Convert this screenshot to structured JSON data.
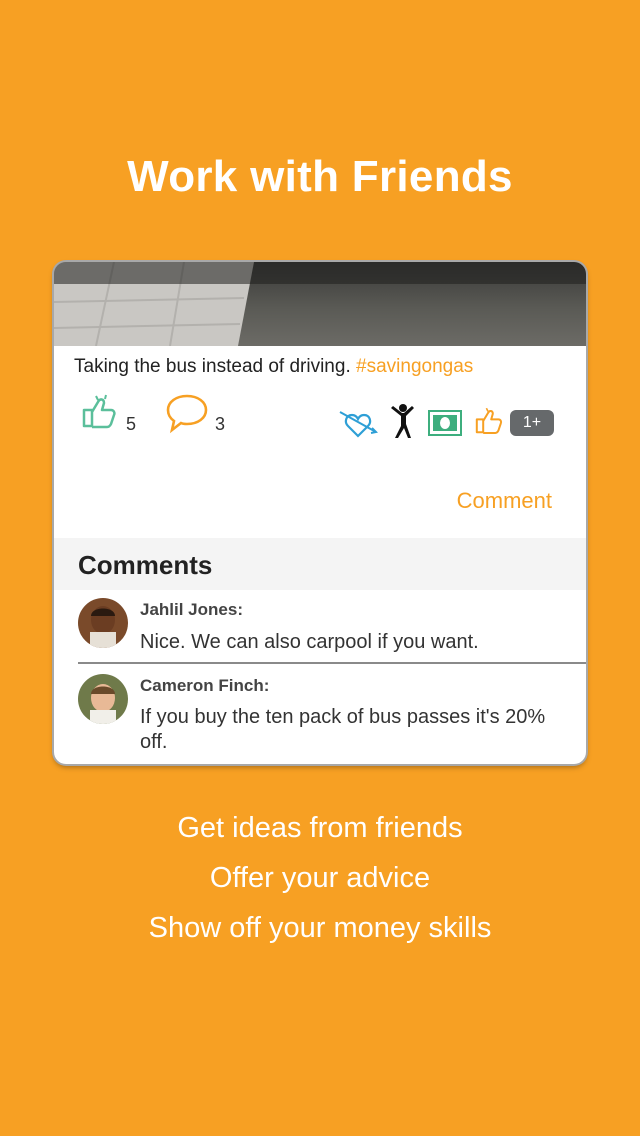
{
  "headline": "Work with Friends",
  "post": {
    "text": "Taking the bus instead of driving.",
    "hashtag": "#savingongas",
    "likes_count": "5",
    "comments_count": "3",
    "more_badge": "1+",
    "comment_link": "Comment"
  },
  "comments": {
    "header": "Comments",
    "items": [
      {
        "name": "Jahlil Jones:",
        "text": "Nice. We can also carpool if you want."
      },
      {
        "name": "Cameron Finch:",
        "text": "If you buy the ten pack of bus passes it's 20% off."
      }
    ]
  },
  "taglines": [
    "Get ideas from friends",
    "Offer your advice",
    "Show off your money skills"
  ],
  "colors": {
    "background": "#F7A023",
    "accent": "#F7A023",
    "like_icon": "#5BBF9B",
    "heart_icon": "#2E9FD6",
    "money_icon": "#3DAE7E"
  }
}
